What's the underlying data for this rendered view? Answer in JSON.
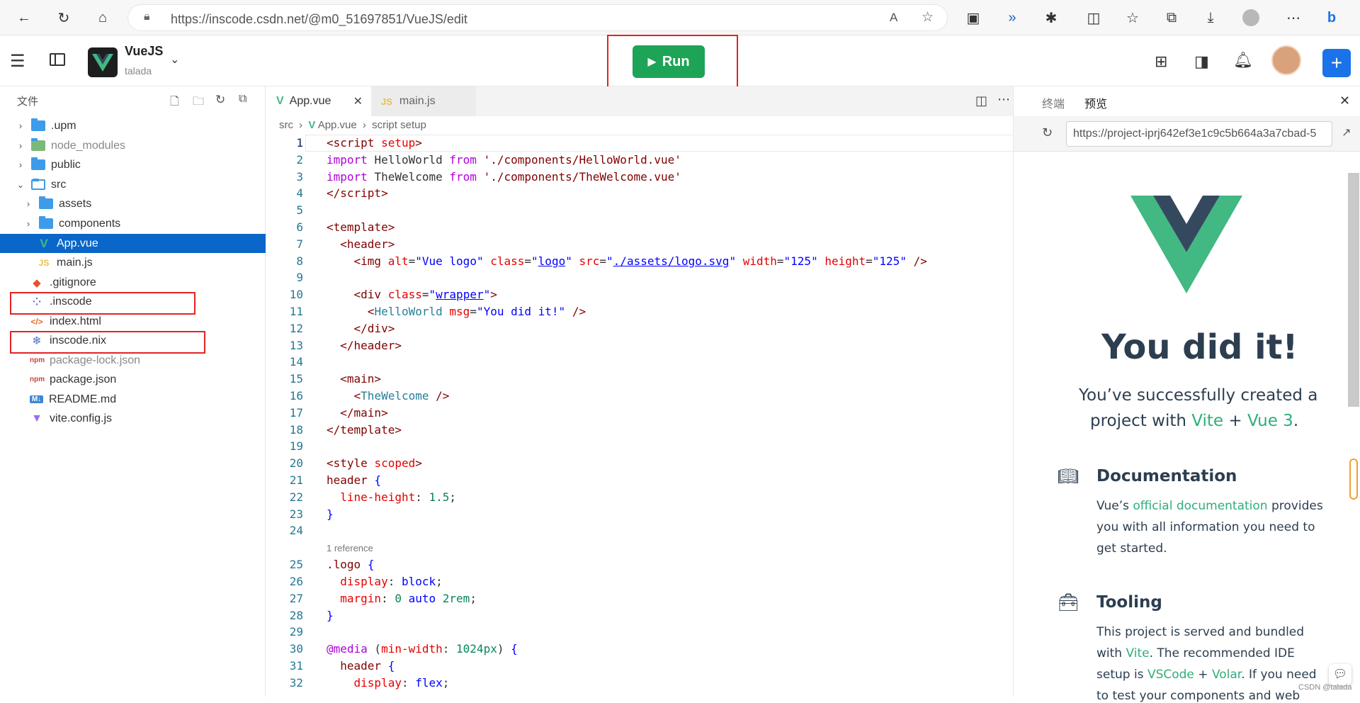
{
  "browser": {
    "url": "https://inscode.csdn.net/@m0_51697851/VueJS/edit"
  },
  "header": {
    "project_name": "VueJS",
    "owner": "talada",
    "run_label": "Run"
  },
  "sidebar": {
    "title": "文件",
    "items": [
      {
        "label": ".upm",
        "type": "folder"
      },
      {
        "label": "node_modules",
        "type": "folder"
      },
      {
        "label": "public",
        "type": "folder"
      },
      {
        "label": "src",
        "type": "folder-open"
      },
      {
        "label": "assets",
        "type": "folder"
      },
      {
        "label": "components",
        "type": "folder"
      },
      {
        "label": "App.vue",
        "type": "vue"
      },
      {
        "label": "main.js",
        "type": "js"
      },
      {
        "label": ".gitignore",
        "type": "git"
      },
      {
        "label": ".inscode",
        "type": "inscode"
      },
      {
        "label": "index.html",
        "type": "html"
      },
      {
        "label": "inscode.nix",
        "type": "nix"
      },
      {
        "label": "package-lock.json",
        "type": "npm"
      },
      {
        "label": "package.json",
        "type": "npm"
      },
      {
        "label": "README.md",
        "type": "md"
      },
      {
        "label": "vite.config.js",
        "type": "vite"
      }
    ]
  },
  "editor": {
    "tabs": [
      {
        "label": "App.vue"
      },
      {
        "label": "main.js"
      }
    ],
    "breadcrumb": [
      "src",
      "App.vue",
      "script setup"
    ],
    "reference_note": "1 reference",
    "line_numbers": [
      "1",
      "2",
      "3",
      "4",
      "5",
      "6",
      "7",
      "8",
      "9",
      "10",
      "11",
      "12",
      "13",
      "14",
      "15",
      "16",
      "17",
      "18",
      "19",
      "20",
      "21",
      "22",
      "23",
      "24",
      "25",
      "26",
      "27",
      "28",
      "29",
      "30",
      "31",
      "32"
    ]
  },
  "preview": {
    "tabs": [
      {
        "label": "终端"
      },
      {
        "label": "预览"
      }
    ],
    "url": "https://project-iprj642ef3e1c9c5b664a3a7cbad-5",
    "headline": "You did it!",
    "sub1": "You’ve successfully created a",
    "sub2a": "project with ",
    "sub2b": "Vite",
    "sub2c": " + ",
    "sub2d": "Vue 3",
    "sub2e": ".",
    "doc_title": "Documentation",
    "doc_l1a": "Vue’s ",
    "doc_l1b": "official documentation",
    "doc_l1c": " provides",
    "doc_l2": "you with all information you need to",
    "doc_l3": "get started.",
    "tool_title": "Tooling",
    "tool_l1": "This project is served and bundled",
    "tool_l2a": "with ",
    "tool_l2b": "Vite",
    "tool_l2c": ". The recommended IDE",
    "tool_l3a": "setup is ",
    "tool_l3b": "VSCode",
    "tool_l3c": " + ",
    "tool_l3d": "Volar",
    "tool_l3e": ". If you need",
    "tool_l4": "to test your components and web",
    "watermark": "CSDN @talada"
  },
  "colors": {
    "run": "#1da456",
    "vue_green": "#42b883",
    "vue_dark": "#35495e",
    "selection": "#0a66c8",
    "highlight": "#e02424"
  }
}
